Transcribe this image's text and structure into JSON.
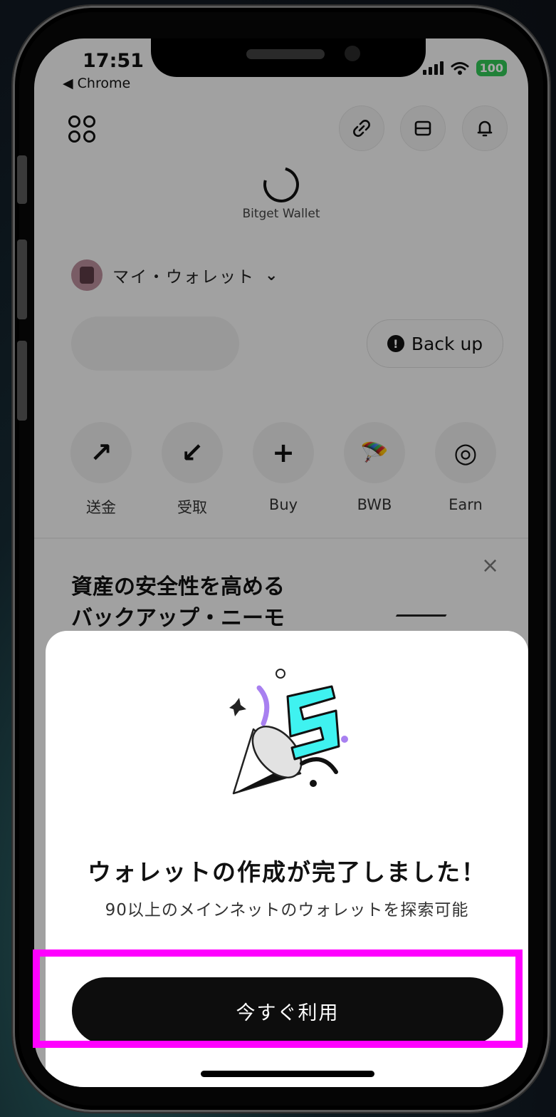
{
  "status_bar": {
    "time": "17:51",
    "back_app": "◀ Chrome",
    "battery": "100"
  },
  "header": {
    "link_icon": "⛓",
    "menu_icon": "☰",
    "bell_icon": "🔔"
  },
  "brand": {
    "name": "Bitget Wallet"
  },
  "wallet": {
    "name": "マイ・ウォレット",
    "chevron": "⌄"
  },
  "backup": {
    "label": "Back up",
    "icon": "!"
  },
  "actions": [
    {
      "label": "送金",
      "glyph": "↗"
    },
    {
      "label": "受取",
      "glyph": "↙"
    },
    {
      "label": "Buy",
      "glyph": "+"
    },
    {
      "label": "BWB",
      "glyph": "🪂"
    },
    {
      "label": "Earn",
      "glyph": "◎"
    }
  ],
  "promo": {
    "title_line1": "資産の安全性を高める",
    "title_line2": "バックアップ・ニーモ",
    "close": "×"
  },
  "sheet": {
    "title": "ウォレットの作成が完了しました！",
    "subtitle": "90以上のメインネットのウォレットを探索可能",
    "cta_label": "今すぐ利用"
  },
  "colors": {
    "accent_cyan": "#3ff2f0",
    "accent_purple": "#a880f0",
    "highlight": "#ff00ff",
    "cta_bg": "#0d0d0d"
  }
}
